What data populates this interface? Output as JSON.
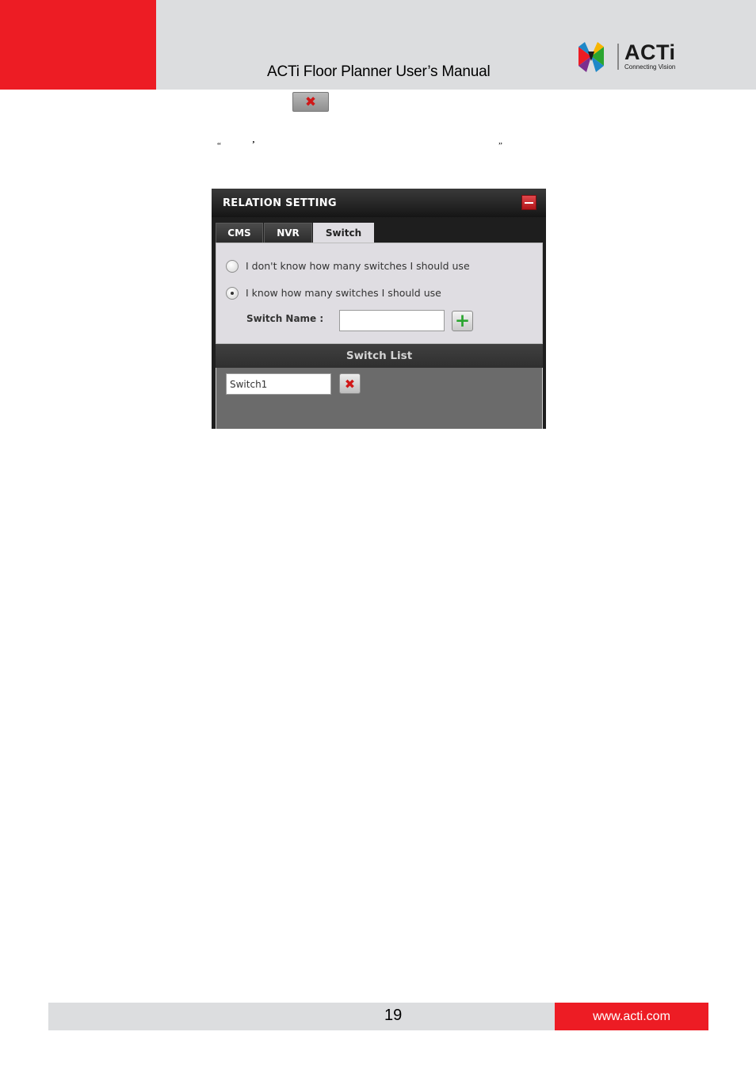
{
  "header": {
    "title": "ACTi Floor Planner User’s Manual",
    "logo": {
      "word": "ACTi",
      "tagline": "Connecting Vision"
    }
  },
  "body_text": {
    "quote_open": "“",
    "comma": "’",
    "quote_close": "”"
  },
  "dialog": {
    "title": "RELATION SETTING",
    "tabs": [
      {
        "label": "CMS",
        "active": false
      },
      {
        "label": "NVR",
        "active": false
      },
      {
        "label": "Switch",
        "active": true
      }
    ],
    "options": [
      {
        "label": "I don't know how many switches I should use",
        "selected": false
      },
      {
        "label": "I know how many switches I should use",
        "selected": true
      }
    ],
    "switch_name_label": "Switch Name :",
    "switch_name_value": "",
    "list_header": "Switch List",
    "switches": [
      "Switch1"
    ]
  },
  "footer": {
    "page_number": "19",
    "website": "www.acti.com"
  },
  "colors": {
    "brand_red": "#ed1c24",
    "header_grey": "#dcdddf"
  }
}
